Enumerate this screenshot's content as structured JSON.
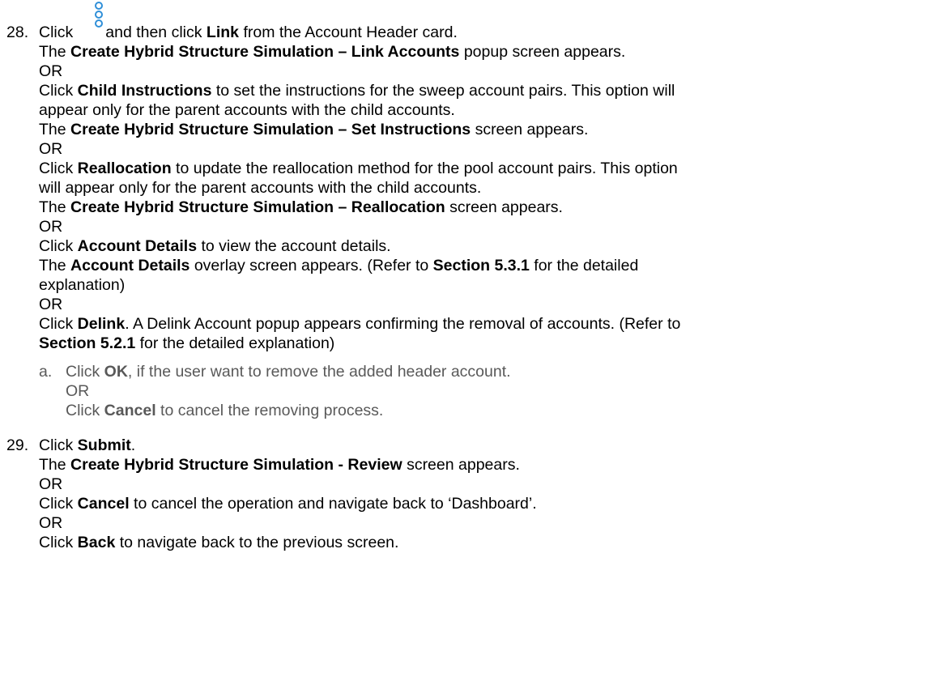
{
  "step28": {
    "number": "28.",
    "click": "Click",
    "after_icon": "and then click",
    "link": "Link",
    "from_card": "from the Account Header card.",
    "icon": "more-options-icon",
    "icon_color": "#2f8fd8",
    "link_accounts": {
      "pre": "The",
      "title": "Create Hybrid Structure Simulation – Link Accounts",
      "post": "popup screen appears."
    },
    "or1": "OR",
    "child_instructions": {
      "click": "Click",
      "label": "Child Instructions",
      "text1": "to set the instructions for the sweep account pairs. This option will",
      "text2": "appear only for the parent accounts with the child accounts."
    },
    "set_instructions": {
      "pre": "The",
      "title": "Create Hybrid Structure Simulation – Set Instructions",
      "post": "screen appears."
    },
    "or2": "OR",
    "reallocation": {
      "click": "Click",
      "label": "Reallocation",
      "text1": "to update the reallocation method for the pool account pairs. This option",
      "text2": "will appear only for the parent accounts with the child accounts."
    },
    "reallocation_screen": {
      "pre": "The",
      "title": "Create Hybrid Structure Simulation – Reallocation",
      "post": "screen appears."
    },
    "or3": "OR",
    "account_details": {
      "click": "Click",
      "label": "Account Details",
      "text": "to view the account details."
    },
    "account_details_overlay": {
      "pre": "The",
      "title": "Account Details",
      "mid": "overlay screen appears. (Refer to",
      "section": "Section 5.3.1",
      "post": "for the detailed",
      "cont": "explanation)"
    },
    "or4": "OR",
    "delink": {
      "click": "Click",
      "label": "Delink",
      "text": ". A Delink Account popup appears confirming the removal of accounts. (Refer to",
      "section": "Section 5.2.1",
      "post": "for the detailed explanation)"
    },
    "sub_a": {
      "letter": "a.",
      "click": "Click",
      "ok": "OK",
      "ok_text": ", if the user want to remove the added header account.",
      "or": "OR",
      "click2": "Click",
      "cancel": "Cancel",
      "cancel_text": "to cancel the removing process."
    }
  },
  "step29": {
    "number": "29.",
    "click": "Click",
    "submit": "Submit",
    "period": ".",
    "review": {
      "pre": "The",
      "title": "Create Hybrid Structure Simulation - Review",
      "post": "screen appears."
    },
    "or1": "OR",
    "cancel": {
      "click": "Click",
      "label": "Cancel",
      "text": "to cancel the operation and navigate back to ‘Dashboard’."
    },
    "or2": "OR",
    "back": {
      "click": "Click",
      "label": "Back",
      "text": "to navigate back to the previous screen."
    }
  }
}
